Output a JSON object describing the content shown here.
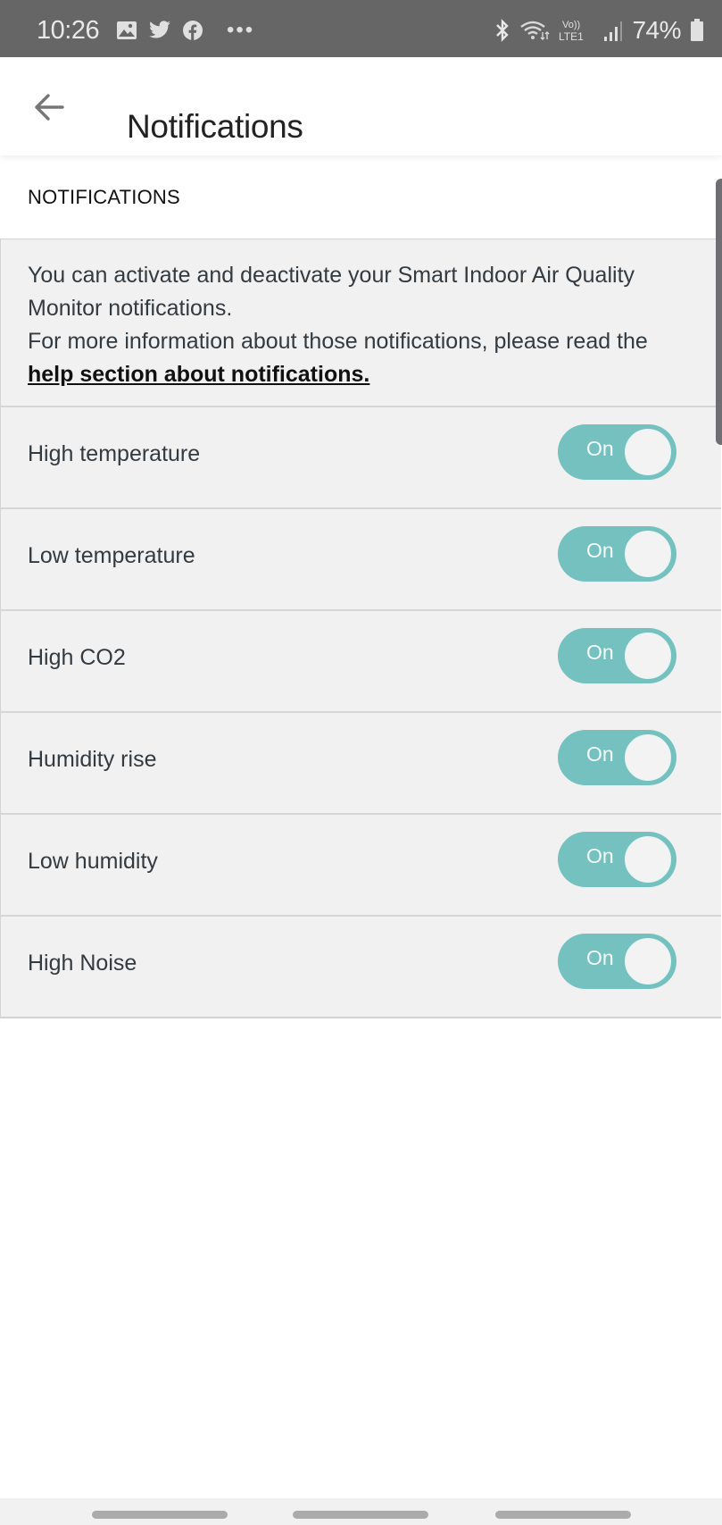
{
  "status_bar": {
    "time": "10:26",
    "notification_icons": [
      "image-icon",
      "twitter-icon",
      "facebook-icon",
      "more-dots-icon"
    ],
    "system_icons": [
      "bluetooth-icon",
      "wifi-icon",
      "volte-lte-icon",
      "signal-icon"
    ],
    "battery_percent": "74%"
  },
  "app_bar": {
    "back_icon": "arrow-left-icon",
    "title": "Notifications"
  },
  "section": {
    "heading": "NOTIFICATIONS"
  },
  "info": {
    "line1": "You can activate and deactivate your Smart Indoor Air Quality Monitor notifications.",
    "line2_prefix": "For more information about those notifications, please read the ",
    "link_text": "help section about notifications."
  },
  "settings": [
    {
      "label": "High temperature",
      "toggle_label": "On",
      "enabled": true
    },
    {
      "label": "Low temperature",
      "toggle_label": "On",
      "enabled": true
    },
    {
      "label": "High CO2",
      "toggle_label": "On",
      "enabled": true
    },
    {
      "label": "Humidity rise",
      "toggle_label": "On",
      "enabled": true
    },
    {
      "label": "Low humidity",
      "toggle_label": "On",
      "enabled": true
    },
    {
      "label": "High Noise",
      "toggle_label": "On",
      "enabled": true
    }
  ],
  "colors": {
    "toggle_on": "#74c1c0",
    "status_bar": "#666666",
    "list_background": "#f1f1f1"
  }
}
